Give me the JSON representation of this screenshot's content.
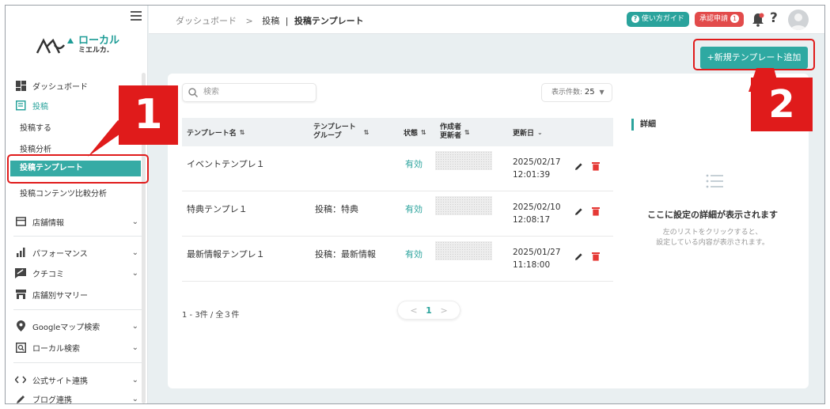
{
  "sidebar": {
    "logo": {
      "line1": "ローカル",
      "line2": "ミエルカ."
    },
    "items": {
      "dashboard": "ダッシュボード",
      "post": "投稿",
      "post_do": "投稿する",
      "post_analysis": "投稿分析",
      "post_template": "投稿テンプレート",
      "post_compare": "投稿コンテンツ比較分析",
      "store_info": "店舗情報",
      "performance": "パフォーマンス",
      "reviews": "クチコミ",
      "store_summary": "店舗別サマリー",
      "gmap_search": "Googleマップ検索",
      "local_search": "ローカル検索",
      "official_site": "公式サイト連携",
      "blog": "ブログ連携"
    }
  },
  "header": {
    "breadcrumb": {
      "root": "ダッシュボード",
      "sep": ">",
      "parent": "投稿",
      "bar": "|",
      "current": "投稿テンプレート"
    },
    "guide_label": "使い方ガイド",
    "approval_label": "承認申請",
    "approval_count": "1",
    "help_label": "?"
  },
  "toolbar": {
    "add_template_label": "+新規テンプレート追加"
  },
  "list": {
    "search_placeholder": "検索",
    "per_page_label": "表示件数:",
    "per_page_value": "25",
    "columns": {
      "name": "テンプレート名",
      "group_l1": "テンプレート",
      "group_l2": "グループ",
      "status": "状態",
      "author_l1": "作成者",
      "author_l2": "更新者",
      "updated": "更新日"
    },
    "rows": [
      {
        "name": "イベントテンプレ１",
        "group": "",
        "status": "有効",
        "date": "2025/02/17",
        "time": "12:01:39"
      },
      {
        "name": "特典テンプレ１",
        "group": "投稿：特典",
        "status": "有効",
        "date": "2025/02/10",
        "time": "12:08:17"
      },
      {
        "name": "最新情報テンプレ１",
        "group": "投稿：最新情報",
        "status": "有効",
        "date": "2025/01/27",
        "time": "11:18:00"
      }
    ],
    "page_info": "1 - 3件 / 全３件",
    "pager": {
      "prev": "<",
      "page": "1",
      "next": ">"
    }
  },
  "detail": {
    "title": "詳細",
    "message": "ここに設定の詳細が表示されます",
    "sub_line1": "左のリストをクリックすると、",
    "sub_line2": "設定している内容が表示されます。"
  },
  "annotations": {
    "callout1": "1",
    "callout2": "2"
  },
  "colors": {
    "accent": "#2aa39c",
    "danger": "#e24b4b",
    "callout": "#e01b1b"
  }
}
